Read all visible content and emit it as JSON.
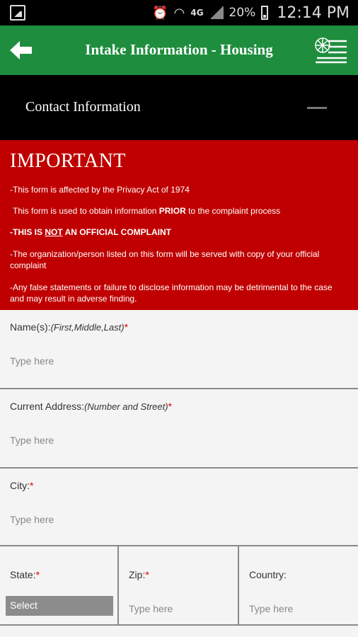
{
  "status_bar": {
    "icons": [
      "gallery-icon",
      "alarm-icon",
      "wifi-icon",
      "signal-icon",
      "battery-icon"
    ],
    "network": "4G",
    "battery": "20%",
    "time": "12:14 PM"
  },
  "app_bar": {
    "title": "Intake Information - Housing",
    "back_icon": "arrow-left-icon",
    "menu_icon": "logo-menu-icon",
    "color": "#1e8e3e"
  },
  "section": {
    "title": "Contact Information",
    "collapse_icon": "minus-icon"
  },
  "important": {
    "heading": "IMPORTANT",
    "line1": "-This form is affected by the Privacy Act of 1974",
    "line2_pre": "This form is used to obtain information ",
    "line2_bold": "PRIOR",
    "line2_post": " to the complaint process",
    "line3_pre": "-THIS IS ",
    "line3_underlined": "NOT",
    "line3_post": " AN OFFICIAL COMPLAINT",
    "line4": "-The organization/person listed on this form will be served with copy of your official complaint",
    "line5": "-Any false statements or failure to disclose information may be detrimental to the case and may result in adverse finding.",
    "color": "#c00000"
  },
  "form": {
    "name": {
      "label": "Name(s):",
      "hint": "(First,Middle,Last)",
      "required": "*",
      "placeholder": "Type here",
      "value": ""
    },
    "address": {
      "label": "Current Address:",
      "hint": "(Number and Street)",
      "required": "*",
      "placeholder": "Type here",
      "value": ""
    },
    "city": {
      "label": "City:",
      "required": "*",
      "placeholder": "Type here",
      "value": ""
    },
    "state": {
      "label": "State:",
      "required": "*",
      "selected": "Select"
    },
    "zip": {
      "label": "Zip:",
      "required": "*",
      "placeholder": "Type here"
    },
    "country": {
      "label": "Country:",
      "placeholder": "Type here"
    }
  }
}
